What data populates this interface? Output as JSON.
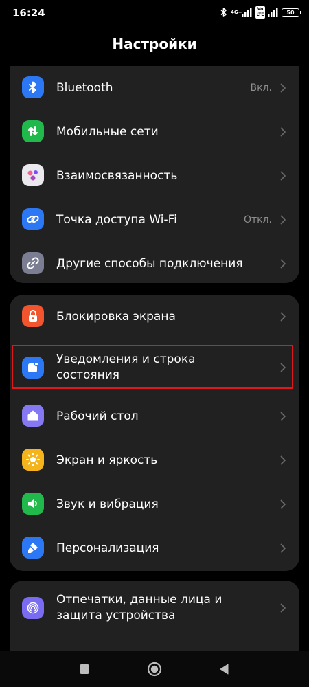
{
  "status_bar": {
    "time": "16:24",
    "network_type": "4G+",
    "volte": "Vo LTE",
    "battery": "50"
  },
  "header": {
    "title": "Настройки"
  },
  "sections": [
    {
      "items": [
        {
          "label": "Bluetooth",
          "value": "Вкл.",
          "icon": "bluetooth-icon",
          "icon_color": "#2c78f4"
        },
        {
          "label": "Мобильные сети",
          "value": "",
          "icon": "mobile-data-icon",
          "icon_color": "#21b94c"
        },
        {
          "label": "Взаимосвязанность",
          "value": "",
          "icon": "connectivity-icon",
          "icon_color": "#e9e9ee"
        },
        {
          "label": "Точка доступа Wi-Fi",
          "value": "Откл.",
          "icon": "hotspot-icon",
          "icon_color": "#2c78f4"
        },
        {
          "label": "Другие способы подключения",
          "value": "",
          "icon": "link-icon",
          "icon_color": "#7b7e93"
        }
      ]
    },
    {
      "items": [
        {
          "label": "Блокировка экрана",
          "value": "",
          "icon": "lock-icon",
          "icon_color": "#f2542d"
        },
        {
          "label": "Уведомления и строка состояния",
          "value": "",
          "icon": "notification-icon",
          "icon_color": "#2c78f4"
        },
        {
          "label": "Рабочий стол",
          "value": "",
          "icon": "home-icon",
          "icon_color": "#8579f3"
        },
        {
          "label": "Экран и яркость",
          "value": "",
          "icon": "brightness-icon",
          "icon_color": "#f6b41c"
        },
        {
          "label": "Звук и вибрация",
          "value": "",
          "icon": "sound-icon",
          "icon_color": "#21b94c"
        },
        {
          "label": "Персонализация",
          "value": "",
          "icon": "brush-icon",
          "icon_color": "#2c78f4"
        }
      ]
    },
    {
      "items": [
        {
          "label": "Отпечатки, данные лица и защита устройства",
          "value": "",
          "icon": "fingerprint-icon",
          "icon_color": "#7a6cf2"
        }
      ]
    }
  ],
  "colors": {
    "background": "#000000",
    "card": "#212121",
    "secondary_text": "#8e8e8e",
    "highlight": "#e0181b"
  }
}
